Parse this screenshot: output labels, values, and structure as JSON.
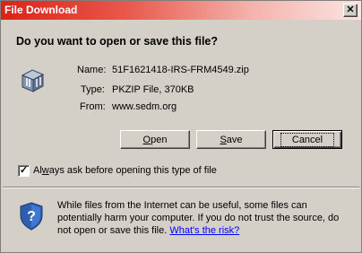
{
  "window": {
    "title": "File Download",
    "close_glyph": "✕"
  },
  "dialog": {
    "question": "Do you want to open or save this file?",
    "file": {
      "name_label": "Name:",
      "name_value": "51F1621418-IRS-FRM4549.zip",
      "type_label": "Type:",
      "type_value": "PKZIP File, 370KB",
      "from_label": "From:",
      "from_value": "www.sedm.org",
      "icon": "zip-archive-icon"
    },
    "buttons": {
      "open_accel": "O",
      "open_rest": "pen",
      "save_accel": "S",
      "save_rest": "ave",
      "cancel": "Cancel"
    },
    "checkbox": {
      "checked": true,
      "check_glyph": "✓",
      "accel": "w",
      "label_prefix": "Al",
      "label_rest": "ays ask before opening this type of file"
    },
    "warning": {
      "icon": "security-shield-icon",
      "text": "While files from the Internet can be useful, some files can potentially harm your computer. If you do not trust the source, do not open or save this file. ",
      "link": "What's the risk?"
    }
  }
}
